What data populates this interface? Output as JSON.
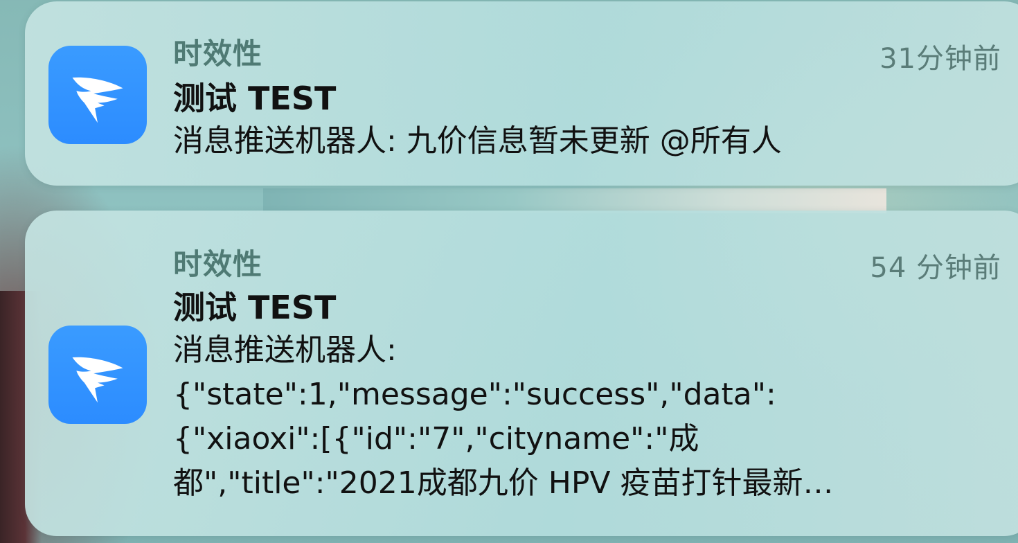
{
  "notifications": [
    {
      "app_name": "时效性",
      "time": "31分钟前",
      "title": "测试 TEST",
      "body": "消息推送机器人: 九价信息暂未更新 @所有人",
      "icon": "dingtalk-wing-icon",
      "accent": "#2c8cff"
    },
    {
      "app_name": "时效性",
      "time": "54 分钟前",
      "title": "测试 TEST",
      "body": "消息推送机器人:\n{\"state\":1,\"message\":\"success\",\"data\":\n{\"xiaoxi\":[{\"id\":\"7\",\"cityname\":\"成\n都\",\"title\":\"2021成都九价 HPV 疫苗打针最新…",
      "icon": "dingtalk-wing-icon",
      "accent": "#2c8cff"
    }
  ]
}
